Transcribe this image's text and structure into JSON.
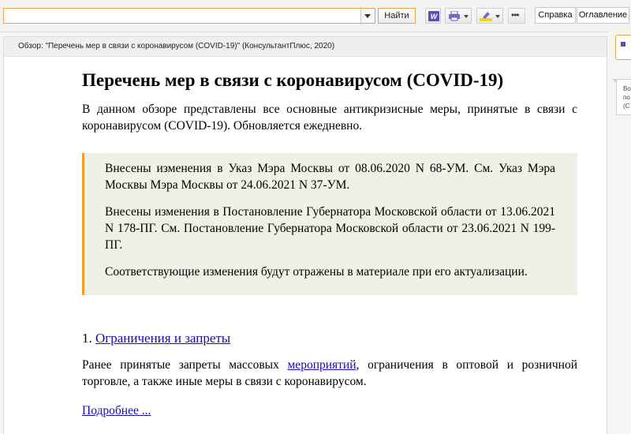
{
  "toolbar": {
    "search_value": "",
    "find_label": "Найти",
    "help_label": "Справка",
    "toc_label": "Оглавление",
    "icons": [
      "chevron-down-icon",
      "word-icon",
      "printer-icon",
      "highlighter-icon",
      "more-icon"
    ]
  },
  "document": {
    "header": "Обзор: \"Перечень мер в связи с коронавирусом (COVID-19)\" (КонсультантПлюс, 2020)",
    "title": "Перечень мер в связи с коронавирусом (COVID-19)",
    "intro": "В данном обзоре представлены все основные антикризисные меры, принятые в связи с коронавирусом (COVID-19). Обновляется ежедневно.",
    "notice": [
      "Внесены изменения в Указ Мэра Москвы от 08.06.2020 N 68-УМ. См. Указ Мэра Москвы Мэра Москвы от 24.06.2021 N 37-УМ.",
      "Внесены изменения в Постановление Губернатора Московской области от 13.06.2021 N 178-ПГ. См. Постановление Губернатора Московской области от 23.06.2021 N 199-ПГ.",
      "Соответствующие изменения будут отражены в материале при его актуализации."
    ],
    "section": {
      "number": "1. ",
      "title": "Ограничения и запреты",
      "text_before": "Ранее принятые запреты массовых ",
      "link": "мероприятий",
      "text_after": ", ограничения в оптовой и розничной торговле, а также иные меры в связи с коронавирусом.",
      "more": "Подробнее ..."
    }
  },
  "right_panel": {
    "tooltip": "Во\nпо\n(С"
  },
  "colors": {
    "accent": "#e0a64a",
    "notice_border": "#f09a28",
    "notice_bg": "#f0f1e6",
    "link": "#1a0dab"
  }
}
